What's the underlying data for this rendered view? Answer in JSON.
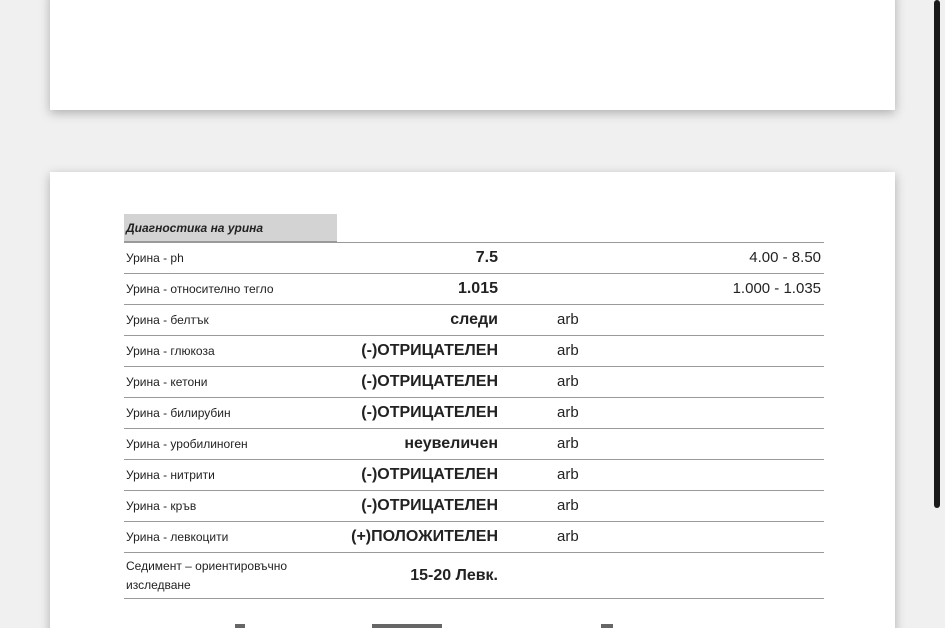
{
  "section": {
    "title": "Диагностика на урина"
  },
  "rows": [
    {
      "name": "Урина - ph",
      "value": "7.5",
      "unit": "",
      "ref": "4.00 - 8.50"
    },
    {
      "name": "Урина - относително тегло",
      "value": "1.015",
      "unit": "",
      "ref": "1.000 - 1.035"
    },
    {
      "name": "Урина - белтък",
      "value": "следи",
      "unit": "arb",
      "ref": ""
    },
    {
      "name": "Урина - глюкоза",
      "value": "(-)ОТРИЦАТЕЛЕН",
      "unit": "arb",
      "ref": ""
    },
    {
      "name": "Урина - кетони",
      "value": "(-)ОТРИЦАТЕЛЕН",
      "unit": "arb",
      "ref": ""
    },
    {
      "name": "Урина - билирубин",
      "value": "(-)ОТРИЦАТЕЛЕН",
      "unit": "arb",
      "ref": ""
    },
    {
      "name": "Урина - уробилиноген",
      "value": "неувеличен",
      "unit": "arb",
      "ref": ""
    },
    {
      "name": "Урина - нитрити",
      "value": "(-)ОТРИЦАТЕЛЕН",
      "unit": "arb",
      "ref": ""
    },
    {
      "name": "Урина - кръв",
      "value": "(-)ОТРИЦАТЕЛЕН",
      "unit": "arb",
      "ref": ""
    },
    {
      "name": "Урина - левкоцити",
      "value": "(+)ПОЛОЖИТЕЛЕН",
      "unit": "arb",
      "ref": ""
    },
    {
      "name": "Седимент – ориентировъчно изследване",
      "value": "15-20 Левк.",
      "unit": "",
      "ref": ""
    }
  ]
}
